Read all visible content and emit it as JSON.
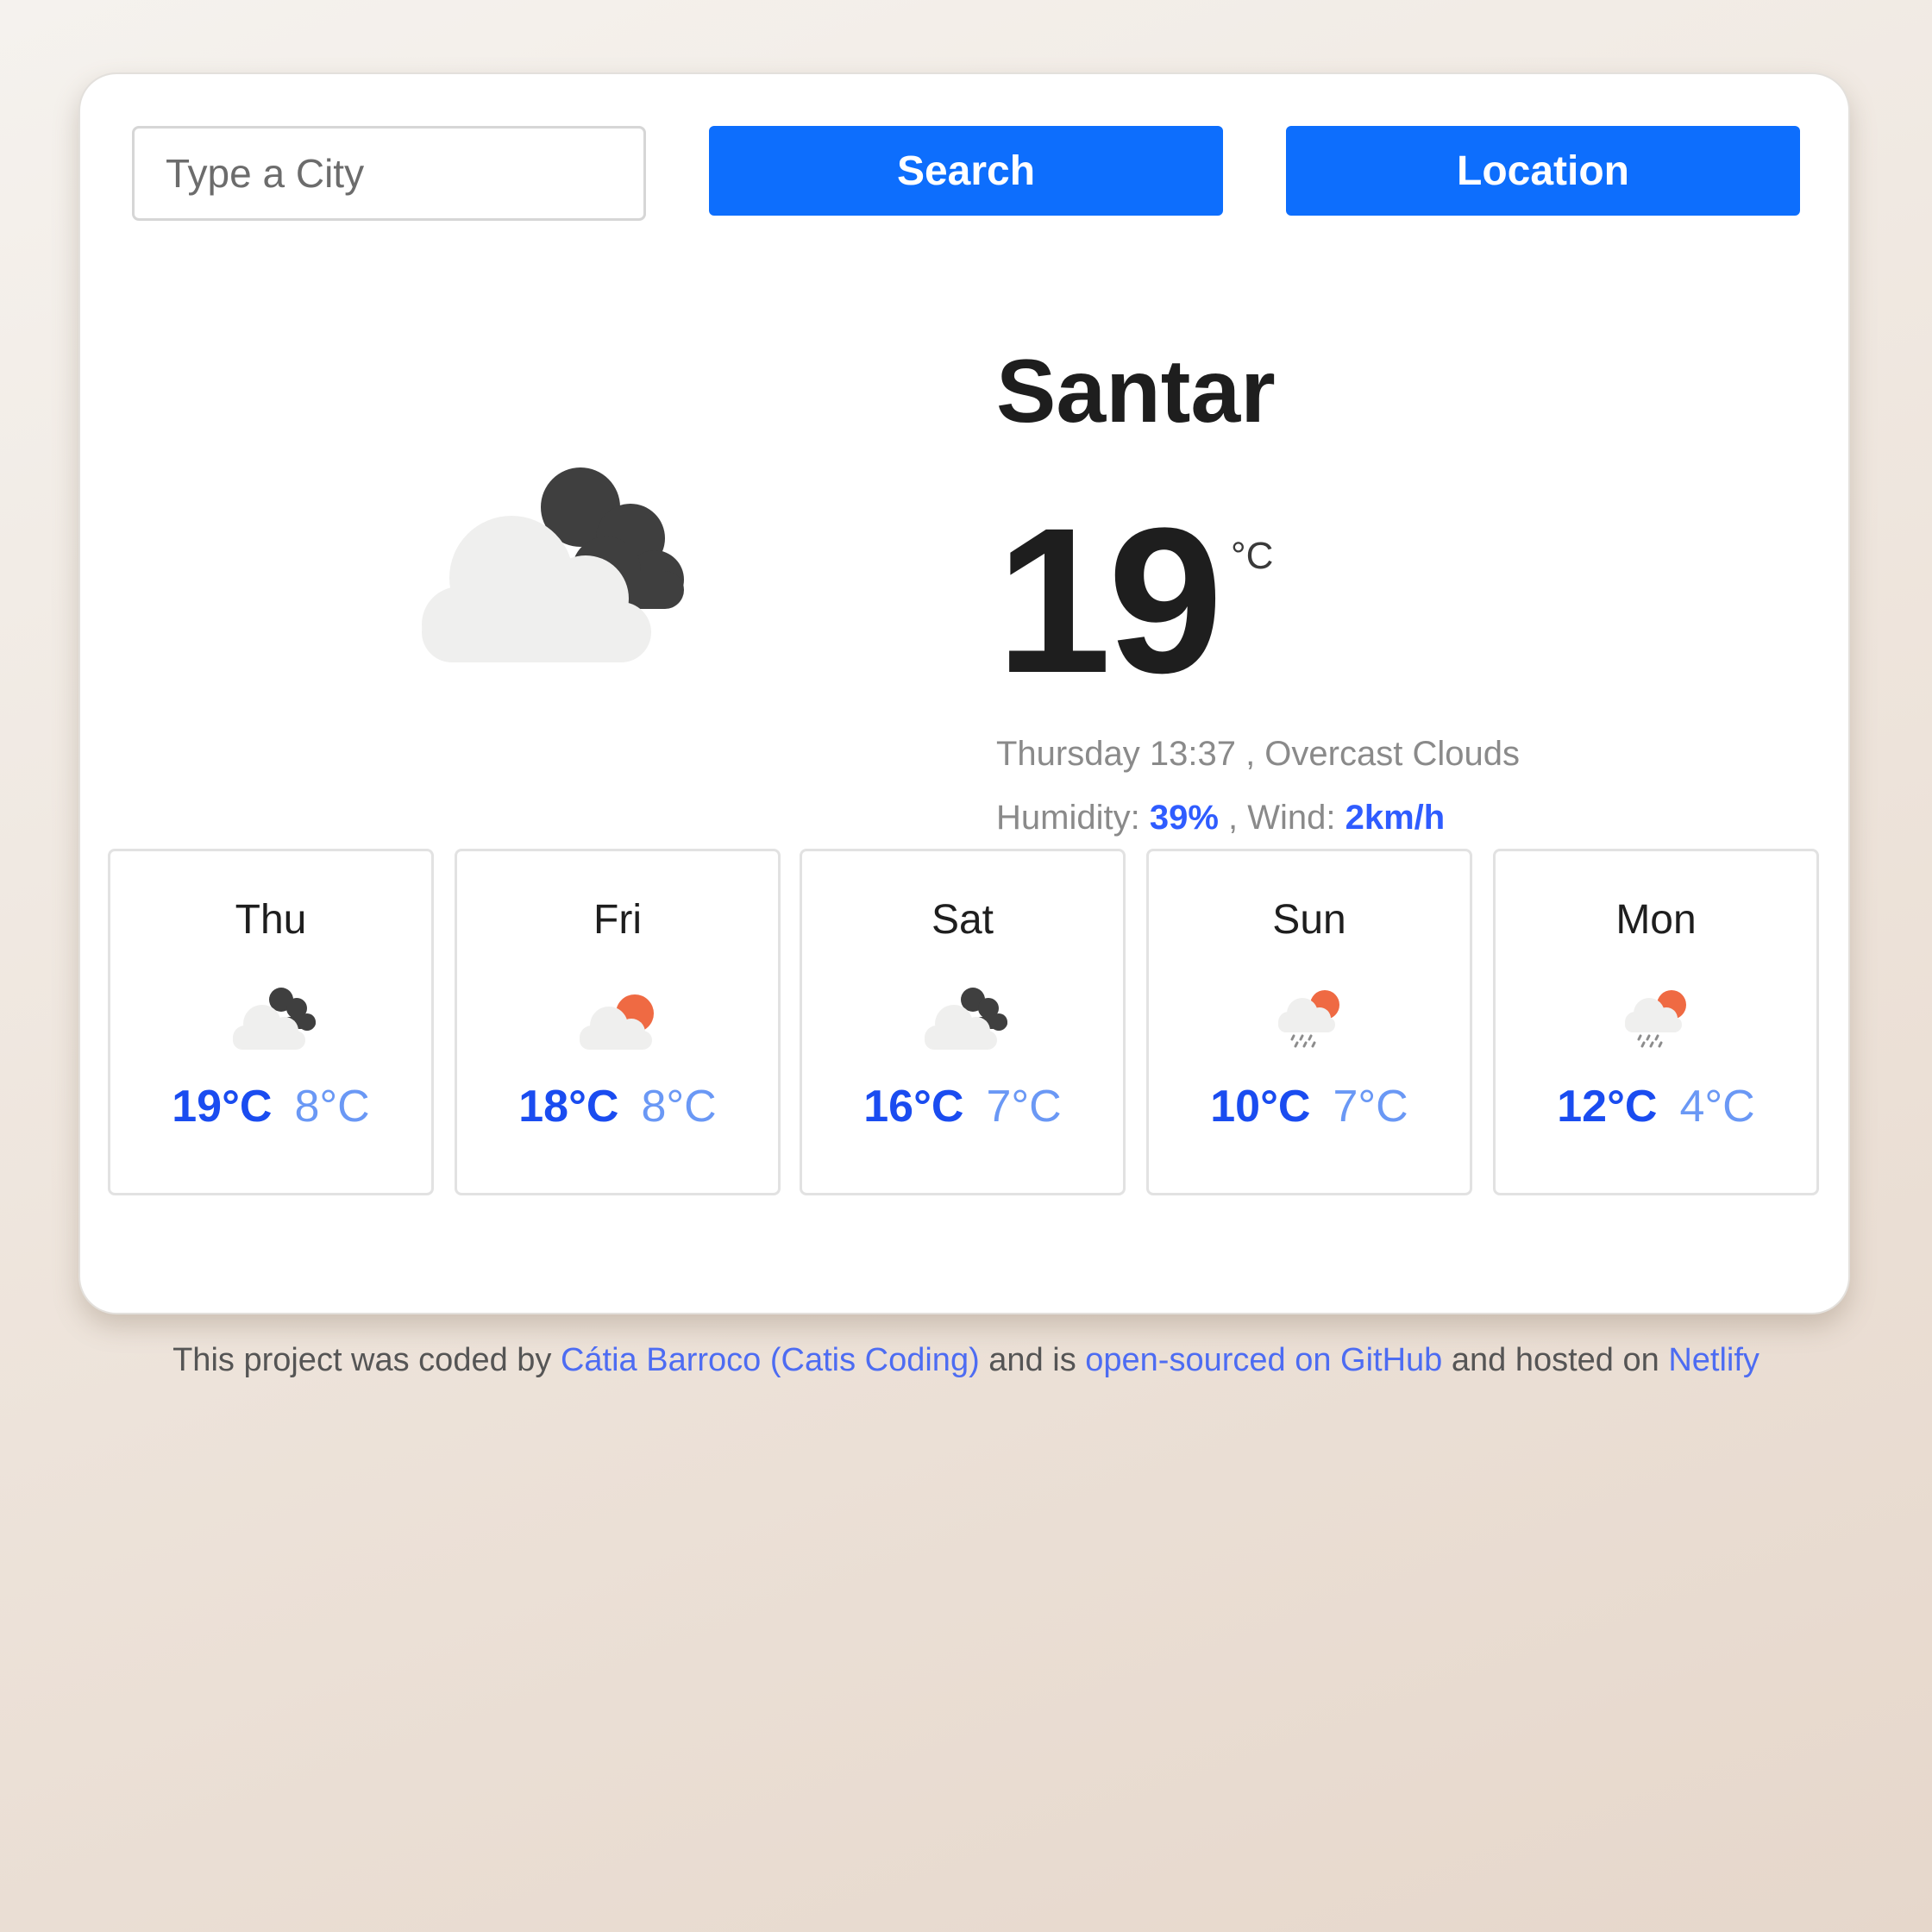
{
  "search": {
    "placeholder": "Type a City",
    "button_label": "Search",
    "location_label": "Location"
  },
  "current": {
    "city": "Santar",
    "temperature": "19",
    "unit": "°C",
    "icon": "overcast-clouds-icon",
    "day_time": "Thursday 13:37",
    "description": "Overcast Clouds",
    "humidity_label": "Humidity:",
    "humidity": "39%",
    "wind_label": "Wind:",
    "wind": "2km/h"
  },
  "forecast": [
    {
      "day": "Thu",
      "icon": "overcast-clouds-icon",
      "max": "19°C",
      "min": "8°C"
    },
    {
      "day": "Fri",
      "icon": "partly-cloudy-icon",
      "max": "18°C",
      "min": "8°C"
    },
    {
      "day": "Sat",
      "icon": "overcast-clouds-icon",
      "max": "16°C",
      "min": "7°C"
    },
    {
      "day": "Sun",
      "icon": "rain-sun-icon",
      "max": "10°C",
      "min": "7°C"
    },
    {
      "day": "Mon",
      "icon": "rain-sun-icon",
      "max": "12°C",
      "min": "4°C"
    }
  ],
  "footer": {
    "prefix": "This project was coded by",
    "author_link": "Cátia Barroco (Catis Coding)",
    "middle": "and is",
    "github_link": "open-sourced on GitHub",
    "middle2": "and hosted on",
    "host_link": "Netlify"
  },
  "colors": {
    "accent": "#0d6efd",
    "highlight": "#2f5cff",
    "max_temp": "#1a4cf0",
    "min_temp": "#6a98f5",
    "sun": "#ef6a43"
  }
}
